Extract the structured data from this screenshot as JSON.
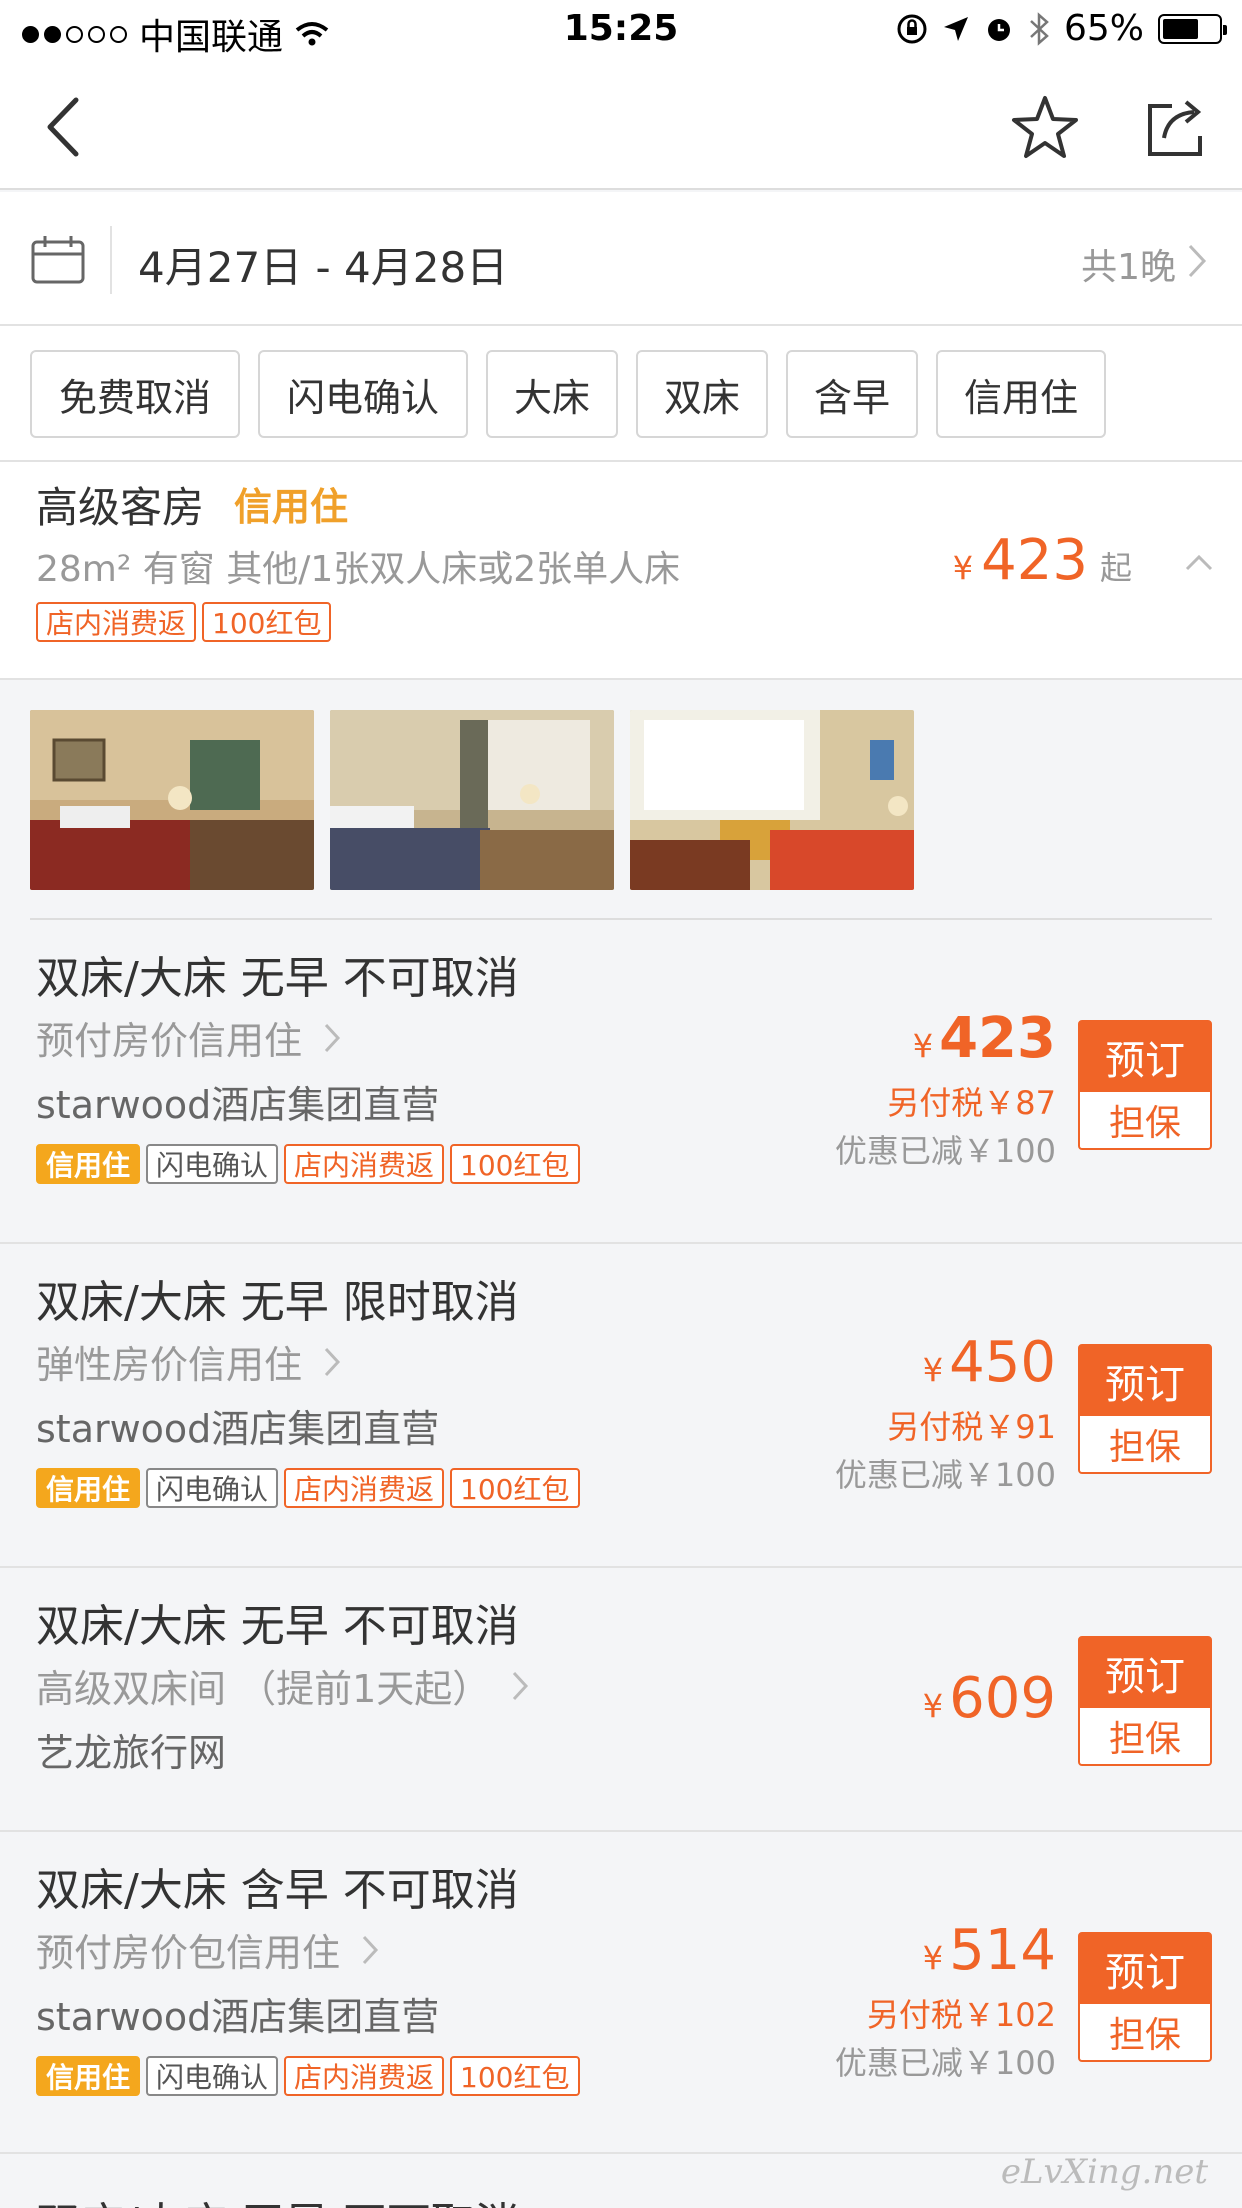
{
  "status": {
    "carrier": "中国联通",
    "time": "15:25",
    "battery": "65%",
    "signal_icon": "signal-dots",
    "wifi_icon": "wifi-icon"
  },
  "nav": {
    "back_icon": "chevron-left-icon",
    "star_icon": "star-icon",
    "share_icon": "share-icon"
  },
  "dates": {
    "range": "4月27日 - 4月28日",
    "nights": "共1晚"
  },
  "filters": [
    "免费取消",
    "闪电确认",
    "大床",
    "双床",
    "含早",
    "信用住"
  ],
  "room": {
    "name": "高级客房",
    "credit_label": "信用住",
    "specs": "28m² 有窗 其他/1张双人床或2张单人床",
    "tags": [
      "店内消费返",
      "100红包"
    ],
    "currency": "¥",
    "price": "423",
    "price_suffix": "起"
  },
  "rates": [
    {
      "title": "双床/大床 无早 不可取消",
      "subtitle": "预付房价信用住",
      "vendor": "starwood酒店集团直营",
      "tags": [
        "信用住",
        "闪电确认",
        "店内消费返",
        "100红包"
      ],
      "currency": "¥",
      "price": "423",
      "tax": "另付税￥87",
      "discount": "优惠已减￥100",
      "book": "预订",
      "guarantee": "担保"
    },
    {
      "title": "双床/大床 无早 限时取消",
      "subtitle": "弹性房价信用住",
      "vendor": "starwood酒店集团直营",
      "tags": [
        "信用住",
        "闪电确认",
        "店内消费返",
        "100红包"
      ],
      "currency": "¥",
      "price": "450",
      "tax": "另付税￥91",
      "discount": "优惠已减￥100",
      "book": "预订",
      "guarantee": "担保"
    },
    {
      "title": "双床/大床 无早 不可取消",
      "subtitle": "高级双床间 （提前1天起）",
      "vendor": "艺龙旅行网",
      "tags": [],
      "currency": "¥",
      "price": "609",
      "tax": "",
      "discount": "",
      "book": "预订",
      "guarantee": "担保"
    },
    {
      "title": "双床/大床 含早 不可取消",
      "subtitle": "预付房价包信用住",
      "vendor": "starwood酒店集团直营",
      "tags": [
        "信用住",
        "闪电确认",
        "店内消费返",
        "100红包"
      ],
      "currency": "¥",
      "price": "514",
      "tax": "另付税￥102",
      "discount": "优惠已减￥100",
      "book": "预订",
      "guarantee": "担保"
    }
  ],
  "watermark": "eLvXing.net",
  "next_row_partial": "双床/大床 无早 不可取消"
}
